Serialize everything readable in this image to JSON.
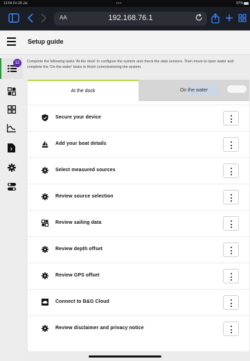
{
  "status_bar": {
    "time": "13:54  Fri 29 Jul",
    "dots": "•••",
    "right": "97%"
  },
  "browser": {
    "aa_label": "AA",
    "url": "192.168.76.1"
  },
  "app": {
    "title": "Setup guide",
    "badge_count": "12"
  },
  "intro_text": "Complete the following tasks 'At the dock' to configure the system and check the data sensors. Then move to open water and complete the 'On the water' tasks to finish commissioning the system.",
  "tabs": {
    "at_dock": "At the dock",
    "on_water": "On the water"
  },
  "tasks": [
    {
      "label": "Secure your device",
      "icon": "shield-icon"
    },
    {
      "label": "Add your boat details",
      "icon": "sailboat-icon"
    },
    {
      "label": "Select measured sources",
      "icon": "gear-icon"
    },
    {
      "label": "Review source selection",
      "icon": "gear-icon"
    },
    {
      "label": "Review sailing data",
      "icon": "grid-icon"
    },
    {
      "label": "Review depth offset",
      "icon": "gear-icon"
    },
    {
      "label": "Review GPS offset",
      "icon": "gear-icon"
    },
    {
      "label": "Connect to B&G Cloud",
      "icon": "cloud-icon"
    },
    {
      "label": "Review disclaimer and privacy notice",
      "icon": "gear-icon"
    }
  ],
  "colors": {
    "accent_tab": "#b6d44a",
    "rail_active": "#1f9f2c",
    "badge": "#5b2ca6",
    "browser_accent": "#3a86ff"
  }
}
